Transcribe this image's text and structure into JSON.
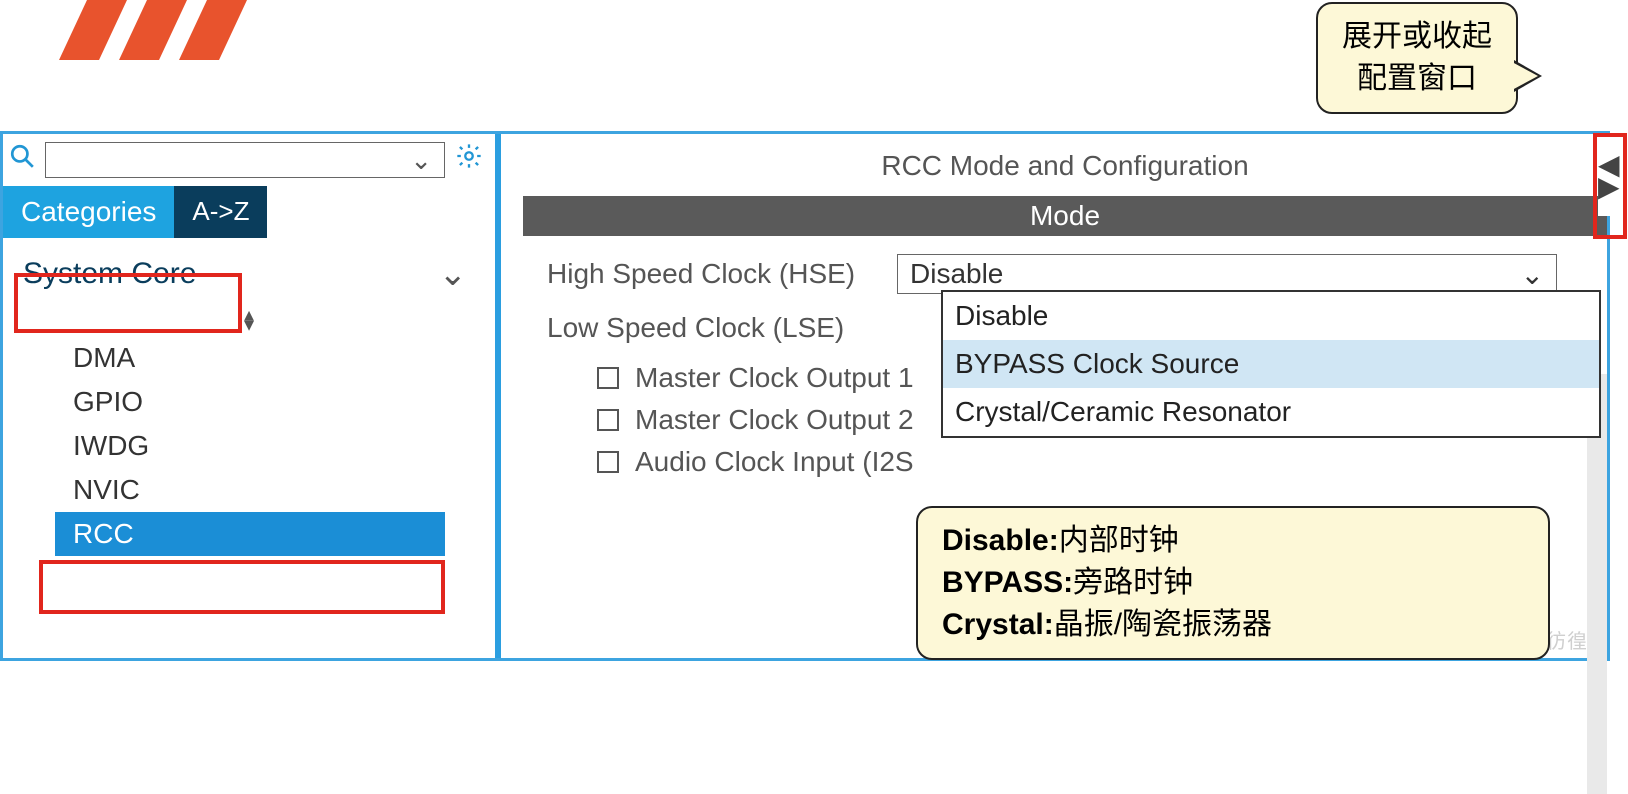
{
  "header": {
    "title": "RCC Mode and Configuration",
    "mode_label": "Mode"
  },
  "sidebar": {
    "tabs": {
      "categories": "Categories",
      "az": "A->Z"
    },
    "category_name": "System Core",
    "chevron": "⌄",
    "sort_up": "▴",
    "sort_down": "▾",
    "items": [
      {
        "label": "DMA"
      },
      {
        "label": "GPIO"
      },
      {
        "label": "IWDG"
      },
      {
        "label": "NVIC"
      },
      {
        "label": "RCC"
      }
    ]
  },
  "form": {
    "hse_label": "High Speed Clock (HSE)",
    "hse_value": "Disable",
    "lse_label": "Low Speed Clock (LSE)",
    "mco1_label": "Master Clock Output 1",
    "mco2_label": "Master Clock Output 2",
    "i2s_label": "Audio Clock Input (I2S",
    "dropdown": {
      "opt0": "Disable",
      "opt1": "BYPASS Clock Source",
      "opt2": "Crystal/Ceramic Resonator"
    }
  },
  "callouts": {
    "top_line1": "展开或收起",
    "top_line2": "配置窗口",
    "b_disable_k": "Disable:",
    "b_disable_v": "内部时钟",
    "b_bypass_k": "BYPASS:",
    "b_bypass_v": "旁路时钟",
    "b_crystal_k": "Crystal:",
    "b_crystal_v": "晶振/陶瓷振荡器"
  },
  "collapse": {
    "left": "◀",
    "right": "▶"
  },
  "watermark": "CSDN @柯西的彷徨"
}
